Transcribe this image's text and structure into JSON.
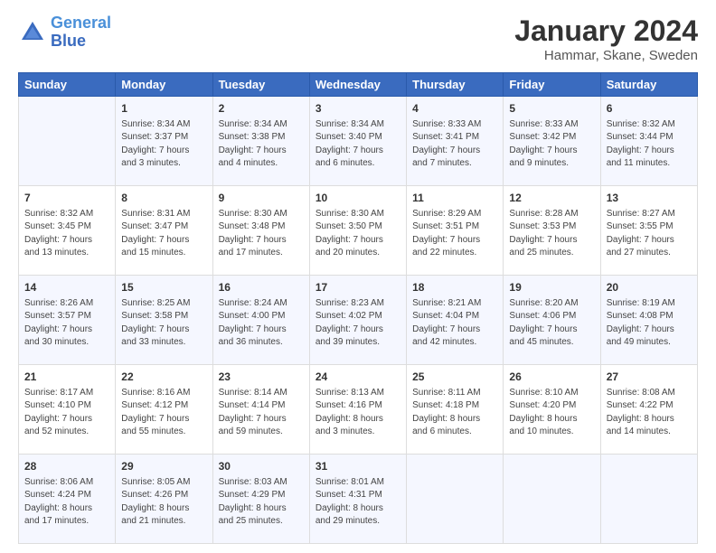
{
  "header": {
    "logo_general": "General",
    "logo_blue": "Blue",
    "main_title": "January 2024",
    "sub_title": "Hammar, Skane, Sweden"
  },
  "days_of_week": [
    "Sunday",
    "Monday",
    "Tuesday",
    "Wednesday",
    "Thursday",
    "Friday",
    "Saturday"
  ],
  "weeks": [
    [
      {
        "day": "",
        "sunrise": "",
        "sunset": "",
        "daylight": ""
      },
      {
        "day": "1",
        "sunrise": "Sunrise: 8:34 AM",
        "sunset": "Sunset: 3:37 PM",
        "daylight": "Daylight: 7 hours and 3 minutes."
      },
      {
        "day": "2",
        "sunrise": "Sunrise: 8:34 AM",
        "sunset": "Sunset: 3:38 PM",
        "daylight": "Daylight: 7 hours and 4 minutes."
      },
      {
        "day": "3",
        "sunrise": "Sunrise: 8:34 AM",
        "sunset": "Sunset: 3:40 PM",
        "daylight": "Daylight: 7 hours and 6 minutes."
      },
      {
        "day": "4",
        "sunrise": "Sunrise: 8:33 AM",
        "sunset": "Sunset: 3:41 PM",
        "daylight": "Daylight: 7 hours and 7 minutes."
      },
      {
        "day": "5",
        "sunrise": "Sunrise: 8:33 AM",
        "sunset": "Sunset: 3:42 PM",
        "daylight": "Daylight: 7 hours and 9 minutes."
      },
      {
        "day": "6",
        "sunrise": "Sunrise: 8:32 AM",
        "sunset": "Sunset: 3:44 PM",
        "daylight": "Daylight: 7 hours and 11 minutes."
      }
    ],
    [
      {
        "day": "7",
        "sunrise": "Sunrise: 8:32 AM",
        "sunset": "Sunset: 3:45 PM",
        "daylight": "Daylight: 7 hours and 13 minutes."
      },
      {
        "day": "8",
        "sunrise": "Sunrise: 8:31 AM",
        "sunset": "Sunset: 3:47 PM",
        "daylight": "Daylight: 7 hours and 15 minutes."
      },
      {
        "day": "9",
        "sunrise": "Sunrise: 8:30 AM",
        "sunset": "Sunset: 3:48 PM",
        "daylight": "Daylight: 7 hours and 17 minutes."
      },
      {
        "day": "10",
        "sunrise": "Sunrise: 8:30 AM",
        "sunset": "Sunset: 3:50 PM",
        "daylight": "Daylight: 7 hours and 20 minutes."
      },
      {
        "day": "11",
        "sunrise": "Sunrise: 8:29 AM",
        "sunset": "Sunset: 3:51 PM",
        "daylight": "Daylight: 7 hours and 22 minutes."
      },
      {
        "day": "12",
        "sunrise": "Sunrise: 8:28 AM",
        "sunset": "Sunset: 3:53 PM",
        "daylight": "Daylight: 7 hours and 25 minutes."
      },
      {
        "day": "13",
        "sunrise": "Sunrise: 8:27 AM",
        "sunset": "Sunset: 3:55 PM",
        "daylight": "Daylight: 7 hours and 27 minutes."
      }
    ],
    [
      {
        "day": "14",
        "sunrise": "Sunrise: 8:26 AM",
        "sunset": "Sunset: 3:57 PM",
        "daylight": "Daylight: 7 hours and 30 minutes."
      },
      {
        "day": "15",
        "sunrise": "Sunrise: 8:25 AM",
        "sunset": "Sunset: 3:58 PM",
        "daylight": "Daylight: 7 hours and 33 minutes."
      },
      {
        "day": "16",
        "sunrise": "Sunrise: 8:24 AM",
        "sunset": "Sunset: 4:00 PM",
        "daylight": "Daylight: 7 hours and 36 minutes."
      },
      {
        "day": "17",
        "sunrise": "Sunrise: 8:23 AM",
        "sunset": "Sunset: 4:02 PM",
        "daylight": "Daylight: 7 hours and 39 minutes."
      },
      {
        "day": "18",
        "sunrise": "Sunrise: 8:21 AM",
        "sunset": "Sunset: 4:04 PM",
        "daylight": "Daylight: 7 hours and 42 minutes."
      },
      {
        "day": "19",
        "sunrise": "Sunrise: 8:20 AM",
        "sunset": "Sunset: 4:06 PM",
        "daylight": "Daylight: 7 hours and 45 minutes."
      },
      {
        "day": "20",
        "sunrise": "Sunrise: 8:19 AM",
        "sunset": "Sunset: 4:08 PM",
        "daylight": "Daylight: 7 hours and 49 minutes."
      }
    ],
    [
      {
        "day": "21",
        "sunrise": "Sunrise: 8:17 AM",
        "sunset": "Sunset: 4:10 PM",
        "daylight": "Daylight: 7 hours and 52 minutes."
      },
      {
        "day": "22",
        "sunrise": "Sunrise: 8:16 AM",
        "sunset": "Sunset: 4:12 PM",
        "daylight": "Daylight: 7 hours and 55 minutes."
      },
      {
        "day": "23",
        "sunrise": "Sunrise: 8:14 AM",
        "sunset": "Sunset: 4:14 PM",
        "daylight": "Daylight: 7 hours and 59 minutes."
      },
      {
        "day": "24",
        "sunrise": "Sunrise: 8:13 AM",
        "sunset": "Sunset: 4:16 PM",
        "daylight": "Daylight: 8 hours and 3 minutes."
      },
      {
        "day": "25",
        "sunrise": "Sunrise: 8:11 AM",
        "sunset": "Sunset: 4:18 PM",
        "daylight": "Daylight: 8 hours and 6 minutes."
      },
      {
        "day": "26",
        "sunrise": "Sunrise: 8:10 AM",
        "sunset": "Sunset: 4:20 PM",
        "daylight": "Daylight: 8 hours and 10 minutes."
      },
      {
        "day": "27",
        "sunrise": "Sunrise: 8:08 AM",
        "sunset": "Sunset: 4:22 PM",
        "daylight": "Daylight: 8 hours and 14 minutes."
      }
    ],
    [
      {
        "day": "28",
        "sunrise": "Sunrise: 8:06 AM",
        "sunset": "Sunset: 4:24 PM",
        "daylight": "Daylight: 8 hours and 17 minutes."
      },
      {
        "day": "29",
        "sunrise": "Sunrise: 8:05 AM",
        "sunset": "Sunset: 4:26 PM",
        "daylight": "Daylight: 8 hours and 21 minutes."
      },
      {
        "day": "30",
        "sunrise": "Sunrise: 8:03 AM",
        "sunset": "Sunset: 4:29 PM",
        "daylight": "Daylight: 8 hours and 25 minutes."
      },
      {
        "day": "31",
        "sunrise": "Sunrise: 8:01 AM",
        "sunset": "Sunset: 4:31 PM",
        "daylight": "Daylight: 8 hours and 29 minutes."
      },
      {
        "day": "",
        "sunrise": "",
        "sunset": "",
        "daylight": ""
      },
      {
        "day": "",
        "sunrise": "",
        "sunset": "",
        "daylight": ""
      },
      {
        "day": "",
        "sunrise": "",
        "sunset": "",
        "daylight": ""
      }
    ]
  ]
}
